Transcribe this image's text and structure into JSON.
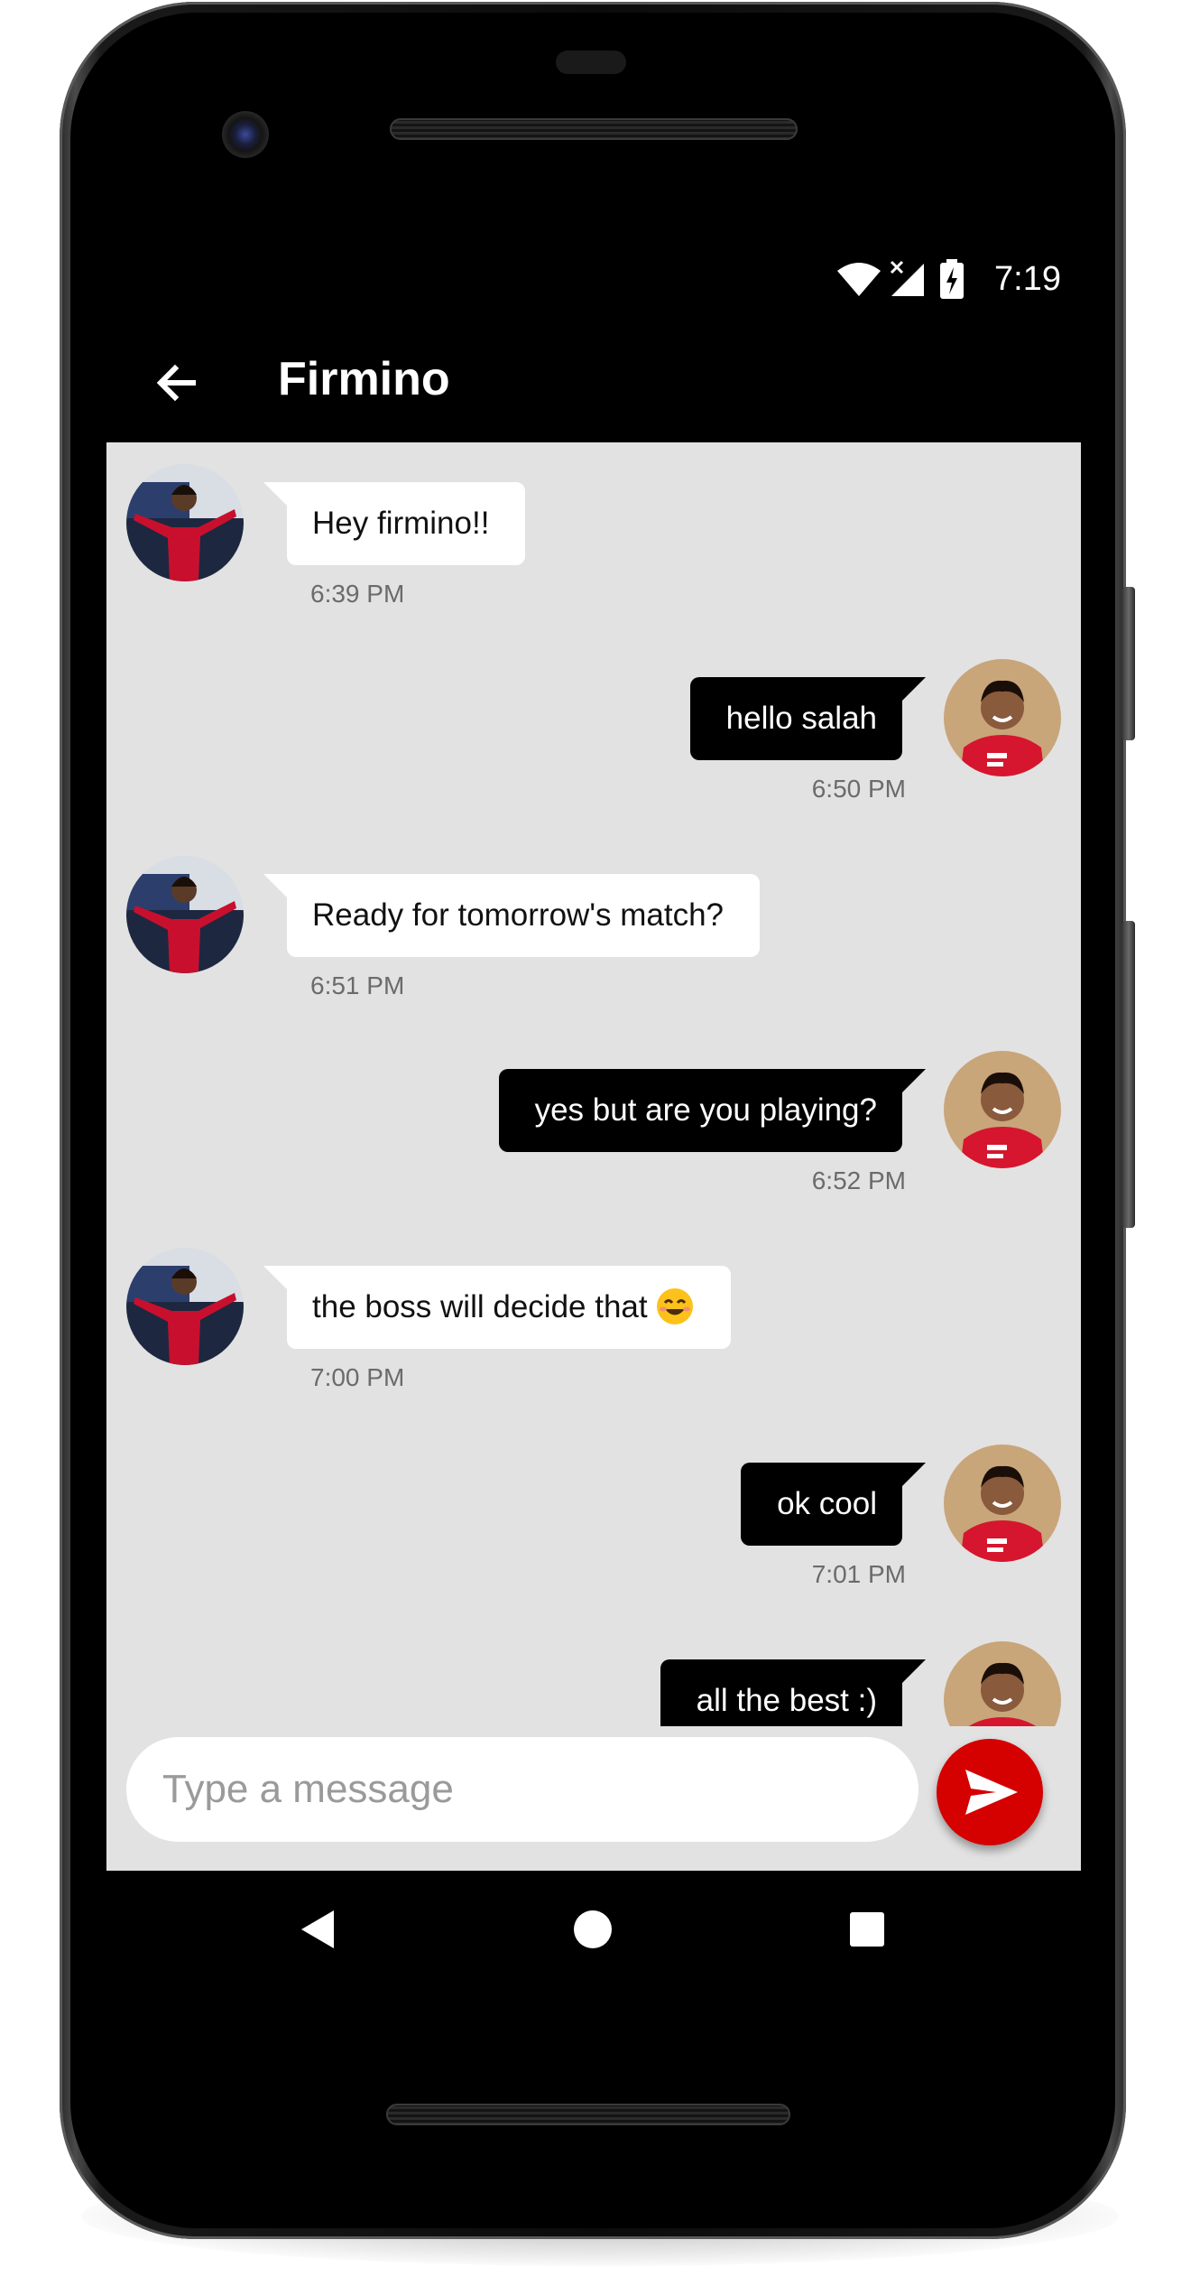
{
  "status_bar": {
    "time": "7:19",
    "icons": [
      "wifi-icon",
      "signal-no-service-icon",
      "battery-charging-icon"
    ]
  },
  "app_bar": {
    "title": "Firmino",
    "back_icon": "arrow-back-icon"
  },
  "messages": [
    {
      "direction": "in",
      "text": "Hey firmino!!",
      "time": "6:39 PM",
      "sender": "salah"
    },
    {
      "direction": "out",
      "text": "hello salah",
      "time": "6:50 PM",
      "sender": "firmino"
    },
    {
      "direction": "in",
      "text": "Ready for tomorrow's match?",
      "time": "6:51 PM",
      "sender": "salah"
    },
    {
      "direction": "out",
      "text": "yes but are you playing?",
      "time": "6:52 PM",
      "sender": "firmino"
    },
    {
      "direction": "in",
      "text": "the boss will decide that",
      "emoji": "smiling-face-emoji",
      "time": "7:00 PM",
      "sender": "salah"
    },
    {
      "direction": "out",
      "text": "ok cool",
      "time": "7:01 PM",
      "sender": "firmino"
    },
    {
      "direction": "out",
      "text": "all the best :)",
      "time": "",
      "sender": "firmino"
    }
  ],
  "composer": {
    "placeholder": "Type a message",
    "value": "",
    "send_icon": "send-icon"
  },
  "nav_bar": {
    "icons": [
      "nav-back-icon",
      "nav-home-icon",
      "nav-recents-icon"
    ]
  },
  "colors": {
    "accent": "#d50000",
    "app_bar": "#000000",
    "chat_background": "#e2e2e2",
    "incoming_bubble": "#ffffff",
    "outgoing_bubble": "#000000"
  }
}
